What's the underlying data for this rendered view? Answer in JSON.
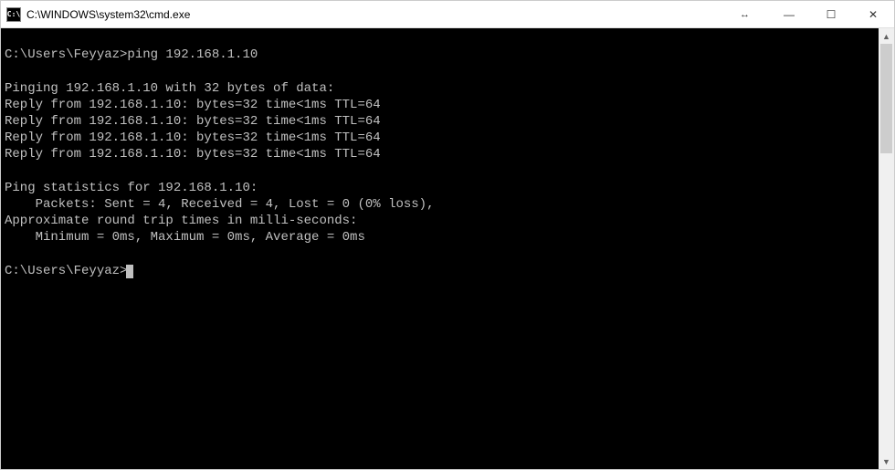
{
  "window": {
    "title": "C:\\WINDOWS\\system32\\cmd.exe",
    "icon_label": "C:\\",
    "extra_glyph": "↔"
  },
  "controls": {
    "minimize": "—",
    "maximize": "☐",
    "close": "✕"
  },
  "scrollbar": {
    "up": "▲",
    "down": "▼"
  },
  "terminal": {
    "lines": [
      "",
      "C:\\Users\\Feyyaz>ping 192.168.1.10",
      "",
      "Pinging 192.168.1.10 with 32 bytes of data:",
      "Reply from 192.168.1.10: bytes=32 time<1ms TTL=64",
      "Reply from 192.168.1.10: bytes=32 time<1ms TTL=64",
      "Reply from 192.168.1.10: bytes=32 time<1ms TTL=64",
      "Reply from 192.168.1.10: bytes=32 time<1ms TTL=64",
      "",
      "Ping statistics for 192.168.1.10:",
      "    Packets: Sent = 4, Received = 4, Lost = 0 (0% loss),",
      "Approximate round trip times in milli-seconds:",
      "    Minimum = 0ms, Maximum = 0ms, Average = 0ms",
      ""
    ],
    "prompt": "C:\\Users\\Feyyaz>"
  }
}
